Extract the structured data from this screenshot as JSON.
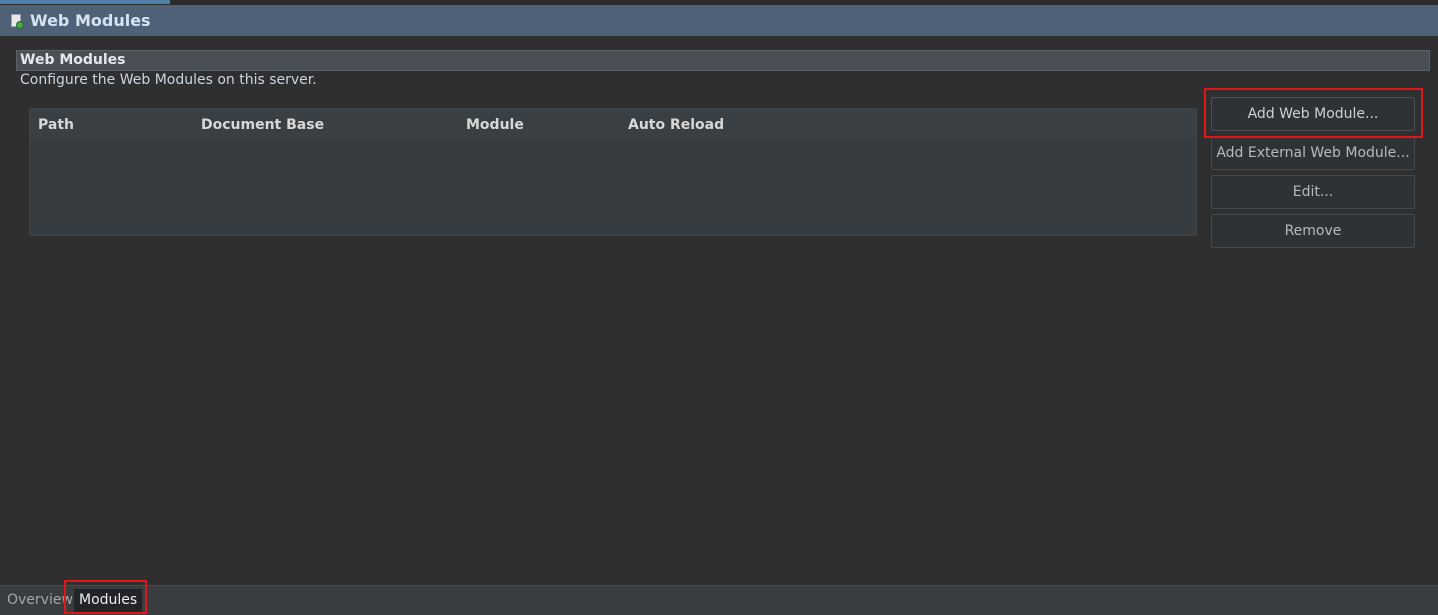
{
  "editor": {
    "title": "Web Modules",
    "icon": "server-config-icon"
  },
  "section": {
    "title": "Web Modules",
    "description": "Configure the Web Modules on this server."
  },
  "table": {
    "columns": [
      "Path",
      "Document Base",
      "Module",
      "Auto Reload"
    ],
    "rows": []
  },
  "buttons": {
    "add": "Add Web Module...",
    "add_external": "Add External Web Module...",
    "edit": "Edit...",
    "remove": "Remove"
  },
  "tabs": {
    "overview": "Overview",
    "modules": "Modules",
    "active": "Modules"
  },
  "colors": {
    "header_bg": "#4f6177",
    "highlight": "#e0161b",
    "background": "#2f2f2f"
  }
}
